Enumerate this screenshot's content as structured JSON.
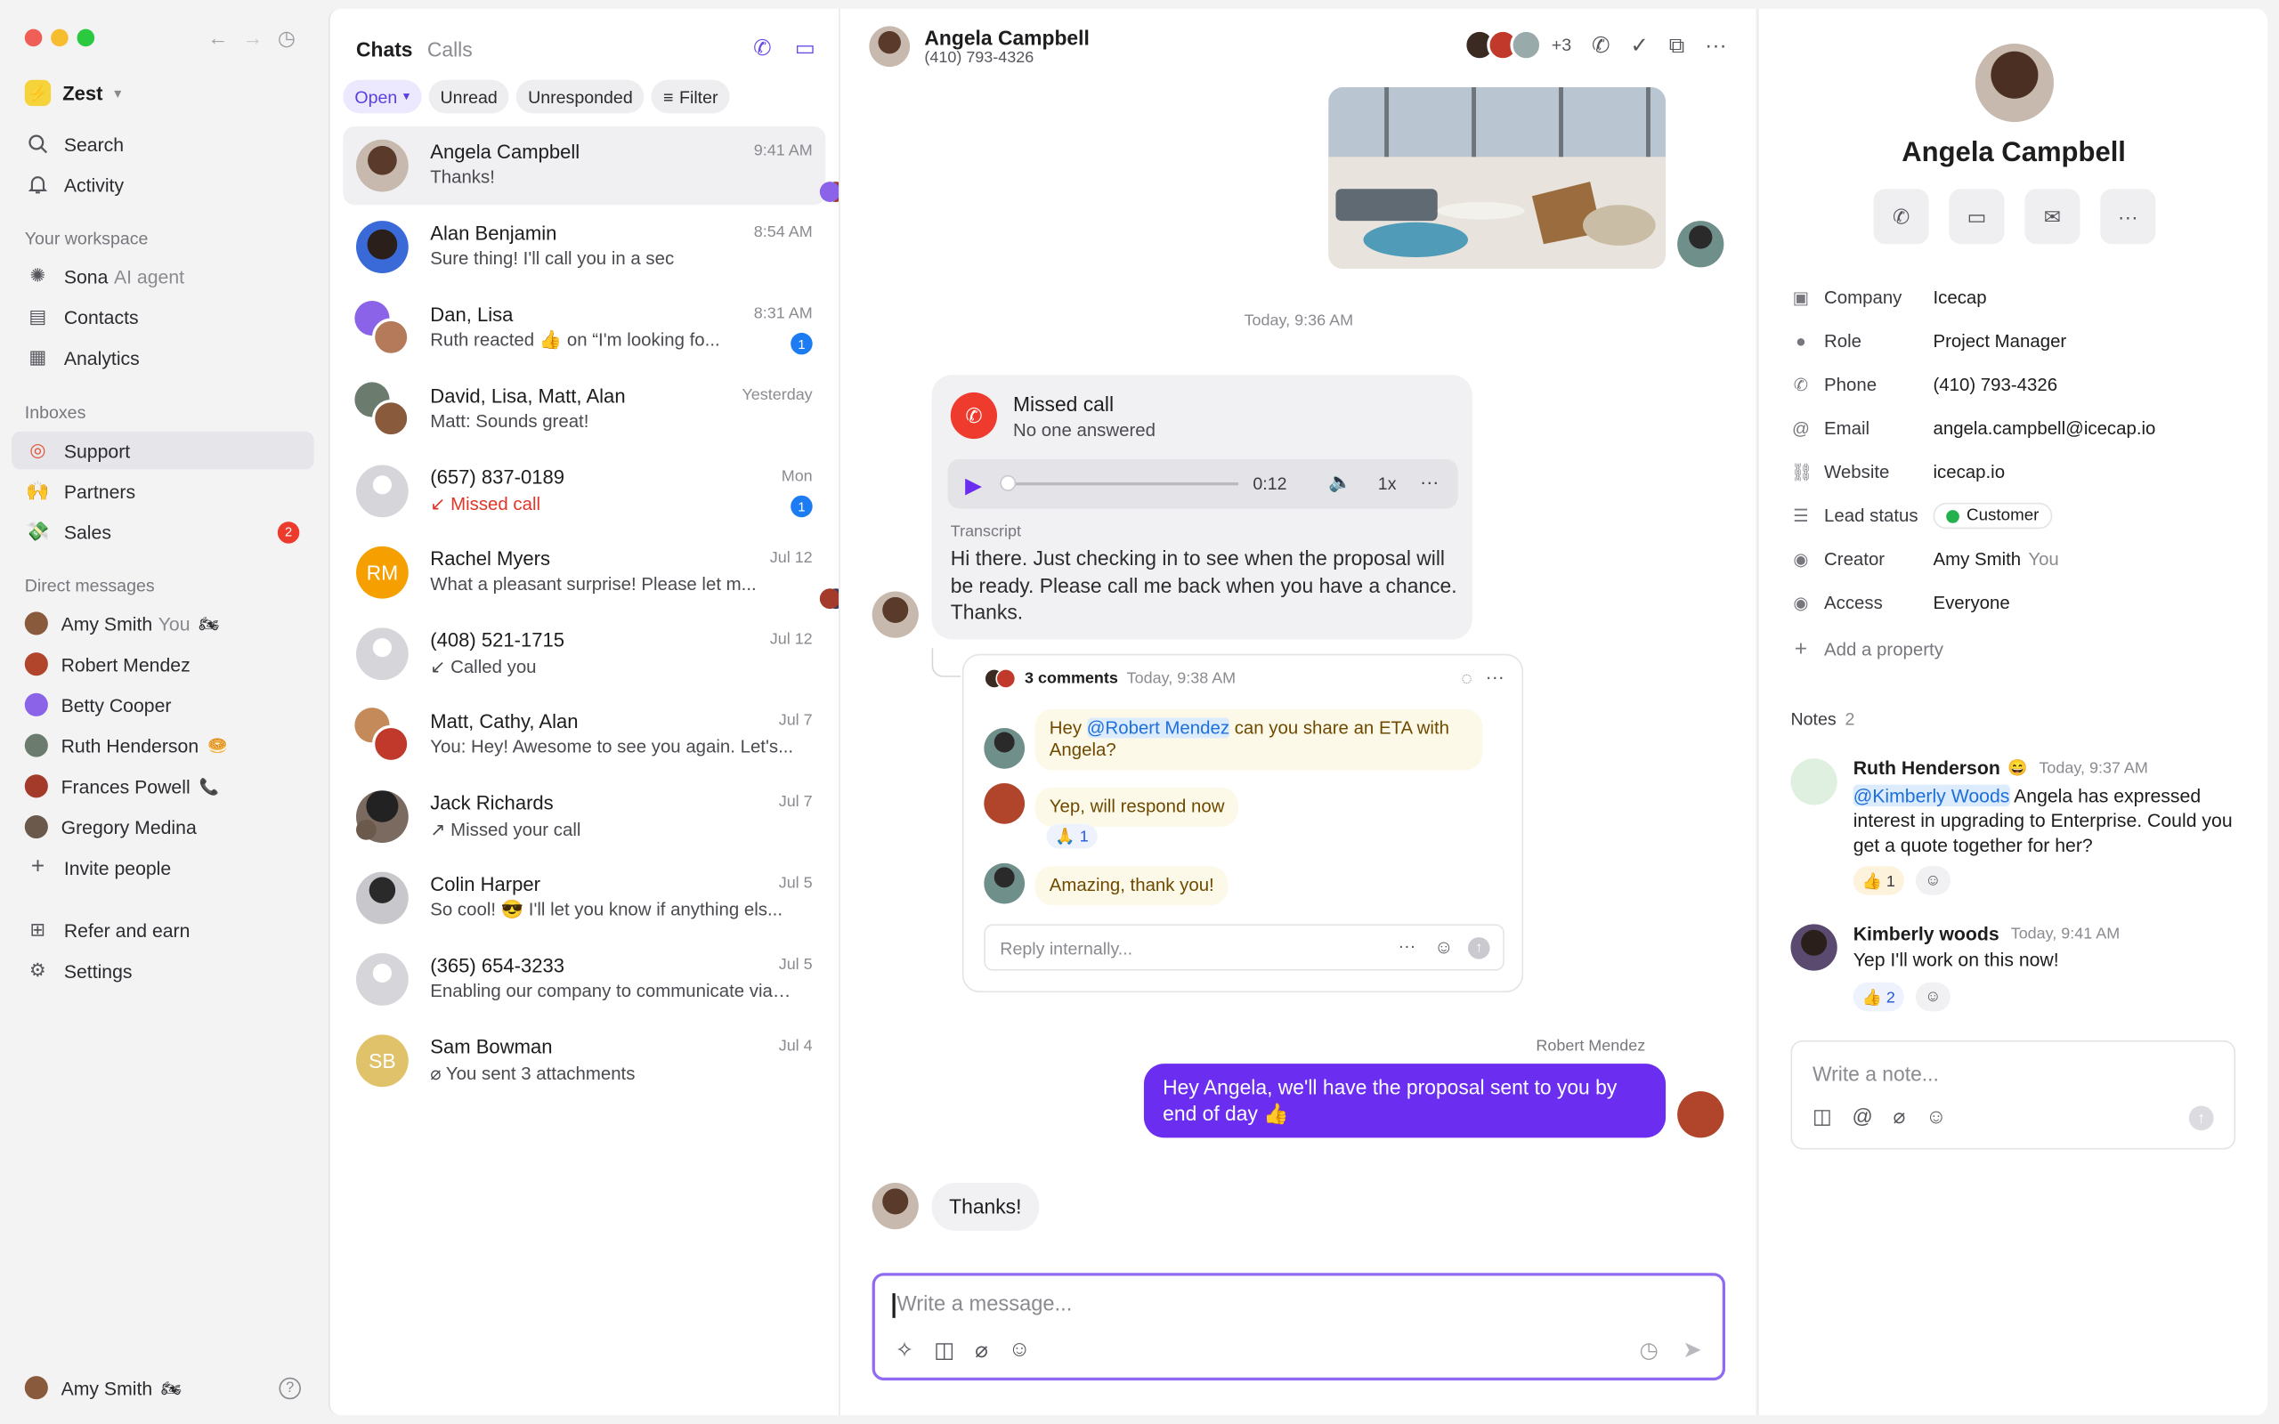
{
  "sidebar": {
    "workspace": "Zest",
    "nav": [
      {
        "label": "Search"
      },
      {
        "label": "Activity"
      }
    ],
    "workspace_header": "Your workspace",
    "workspace_items": [
      {
        "label": "Sona",
        "sub": "AI agent"
      },
      {
        "label": "Contacts"
      },
      {
        "label": "Analytics"
      }
    ],
    "inboxes_header": "Inboxes",
    "inboxes": [
      {
        "label": "Support"
      },
      {
        "label": "Partners"
      },
      {
        "label": "Sales",
        "badge": "2"
      }
    ],
    "dm_header": "Direct messages",
    "dms": [
      {
        "label": "Amy Smith",
        "sub": "You",
        "emoji": "🏍"
      },
      {
        "label": "Robert Mendez"
      },
      {
        "label": "Betty Cooper"
      },
      {
        "label": "Ruth Henderson",
        "emoji": "🥯"
      },
      {
        "label": "Frances Powell",
        "emoji": "📞"
      },
      {
        "label": "Gregory Medina"
      }
    ],
    "invite": "Invite people",
    "refer": "Refer and earn",
    "settings": "Settings",
    "user": "Amy Smith",
    "user_emoji": "🏍"
  },
  "list": {
    "tab_chats": "Chats",
    "tab_calls": "Calls",
    "chips": {
      "open": "Open",
      "unread": "Unread",
      "unresponded": "Unresponded",
      "filter": "Filter"
    },
    "rows": [
      {
        "name": "Angela Campbell",
        "preview": "Thanks!",
        "time": "9:41 AM"
      },
      {
        "name": "Alan Benjamin",
        "preview": "Sure thing! I'll call you in a sec",
        "time": "8:54 AM"
      },
      {
        "name": "Dan, Lisa",
        "preview": "Ruth reacted 👍 on “I'm looking fo...",
        "time": "8:31 AM",
        "badge": "1"
      },
      {
        "name": "David, Lisa, Matt, Alan",
        "preview": "Matt: Sounds great!",
        "time": "Yesterday"
      },
      {
        "name": "(657) 837-0189",
        "preview": "Missed call",
        "time": "Mon",
        "badge": "1"
      },
      {
        "name": "Rachel Myers",
        "preview": "What a pleasant surprise! Please let m...",
        "time": "Jul 12",
        "initials": "RM"
      },
      {
        "name": "(408) 521-1715",
        "preview": "Called you",
        "time": "Jul 12"
      },
      {
        "name": "Matt, Cathy, Alan",
        "preview": "You: Hey! Awesome to see you again. Let's...",
        "time": "Jul 7"
      },
      {
        "name": "Jack Richards",
        "preview": "Missed your call",
        "time": "Jul 7"
      },
      {
        "name": "Colin Harper",
        "preview": "So cool! 😎 I'll let you know if anything els...",
        "time": "Jul 5"
      },
      {
        "name": "(365) 654-3233",
        "preview": "Enabling our company to communicate via t...",
        "time": "Jul 5"
      },
      {
        "name": "Sam Bowman",
        "preview": "You sent 3 attachments",
        "time": "Jul 4",
        "initials": "SB"
      }
    ]
  },
  "conv": {
    "name": "Angela Campbell",
    "phone": "(410) 793-4326",
    "extra": "+3",
    "date_sep": "Today, 9:36 AM",
    "missed_title": "Missed call",
    "missed_sub": "No one answered",
    "duration": "0:12",
    "speed": "1x",
    "transcript_label": "Transcript",
    "transcript": "Hi there. Just checking in to see when the proposal will be ready. Please call me back when you have a chance. Thanks.",
    "thread_count": "3 comments",
    "thread_time": "Today, 9:38 AM",
    "c1_pre": "Hey ",
    "c1_mention": "@Robert Mendez",
    "c1_post": " can you share an ETA with Angela?",
    "c2": "Yep, will respond now",
    "c2_react": "🙏 1",
    "c3": "Amazing, thank you!",
    "reply_placeholder": "Reply internally...",
    "sender": "Robert Mendez",
    "out": "Hey Angela, we'll have the proposal sent to you by end of day 👍",
    "in": "Thanks!",
    "composer_placeholder": "Write a message..."
  },
  "contact": {
    "name": "Angela Campbell",
    "props": [
      {
        "k": "Company",
        "v": "Icecap"
      },
      {
        "k": "Role",
        "v": "Project Manager"
      },
      {
        "k": "Phone",
        "v": "(410) 793-4326"
      },
      {
        "k": "Email",
        "v": "angela.campbell@icecap.io"
      },
      {
        "k": "Website",
        "v": "icecap.io"
      },
      {
        "k": "Lead status",
        "v": "Customer"
      },
      {
        "k": "Creator",
        "v": "Amy Smith",
        "sub": "You"
      },
      {
        "k": "Access",
        "v": "Everyone"
      }
    ],
    "add_prop": "Add a property",
    "notes_label": "Notes",
    "notes_count": "2",
    "n1_author": "Ruth Henderson",
    "n1_emoji": "😄",
    "n1_time": "Today, 9:37 AM",
    "n1_mention": "@Kimberly Woods",
    "n1_text": " Angela has expressed interest in upgrading to Enterprise. Could you get a quote together for her?",
    "n1_react": "👍 1",
    "n2_author": "Kimberly woods",
    "n2_time": "Today, 9:41 AM",
    "n2_text": "Yep I'll work on this now!",
    "n2_react": "👍 2",
    "note_placeholder": "Write a note..."
  },
  "colors": {
    "accent": "#6b2df0",
    "missed": "#ef3b2d",
    "badge_blue": "#1e7cf2",
    "badge_red": "#ec3a2c",
    "customer": "#22b14c"
  }
}
